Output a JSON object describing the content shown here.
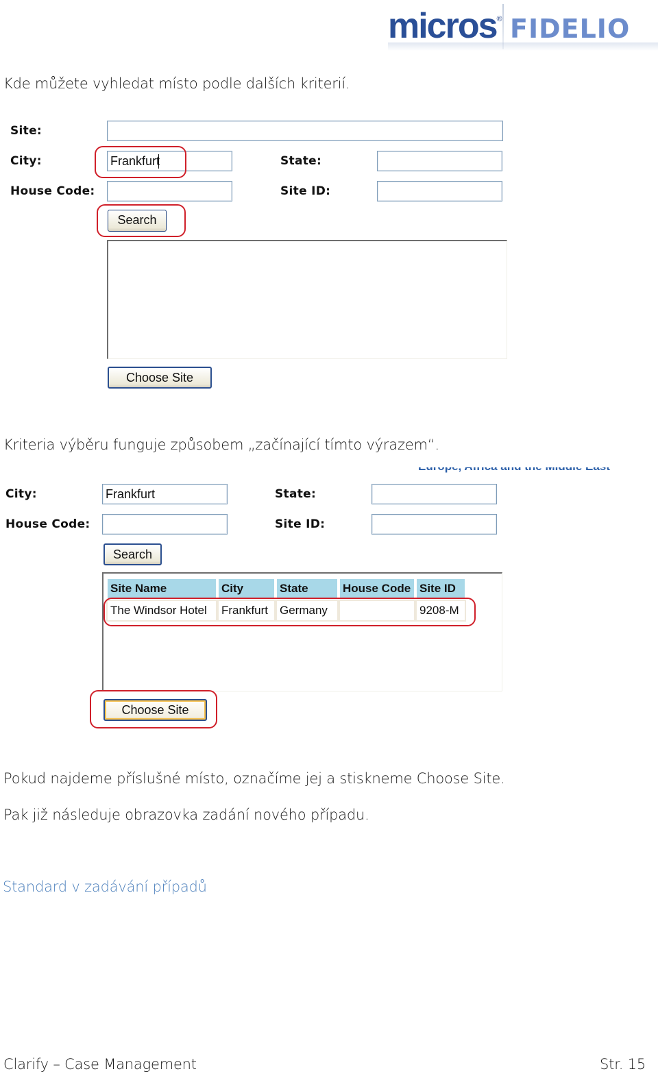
{
  "logo": {
    "brand": "micros",
    "registered_mark": "®",
    "product": "FIDELIO"
  },
  "intro_text": "Kde můžete vyhledat místo podle dalších kriterií.",
  "screenshot1": {
    "labels": {
      "site": "Site:",
      "city": "City:",
      "state": "State:",
      "house_code": "House Code:",
      "site_id": "Site ID:"
    },
    "values": {
      "site": "",
      "city": "Frankfurt",
      "state": "",
      "house_code": "",
      "site_id": ""
    },
    "search_button": "Search",
    "choose_site_button": "Choose Site",
    "highlight_color": "#d0202a"
  },
  "criteria_text": "Kriteria výběru funguje způsobem „začínající tímto výrazem“.",
  "screenshot2": {
    "clipped_region_text": "Europe, Africa and the Middle East",
    "labels": {
      "city": "City:",
      "state": "State:",
      "house_code": "House Code:",
      "site_id": "Site ID:"
    },
    "values": {
      "city": "Frankfurt",
      "state": "",
      "house_code": "",
      "site_id": ""
    },
    "search_button": "Search",
    "results": {
      "columns": [
        "Site Name",
        "City",
        "State",
        "House Code",
        "Site ID"
      ],
      "rows": [
        [
          "The Windsor Hotel",
          "Frankfurt",
          "Germany",
          "",
          "9208-M"
        ]
      ],
      "header_color": "#a8d8e8"
    },
    "choose_site_button": "Choose Site"
  },
  "paragraphs": [
    "Pokud najdeme příslušné místo, označíme jej a stiskneme Choose Site.",
    "Pak již následuje obrazovka zadání nového případu."
  ],
  "section_link": "Standard v zadávání případů",
  "footer": {
    "title": "Clarify – Case Management",
    "page": "Str. 15"
  }
}
